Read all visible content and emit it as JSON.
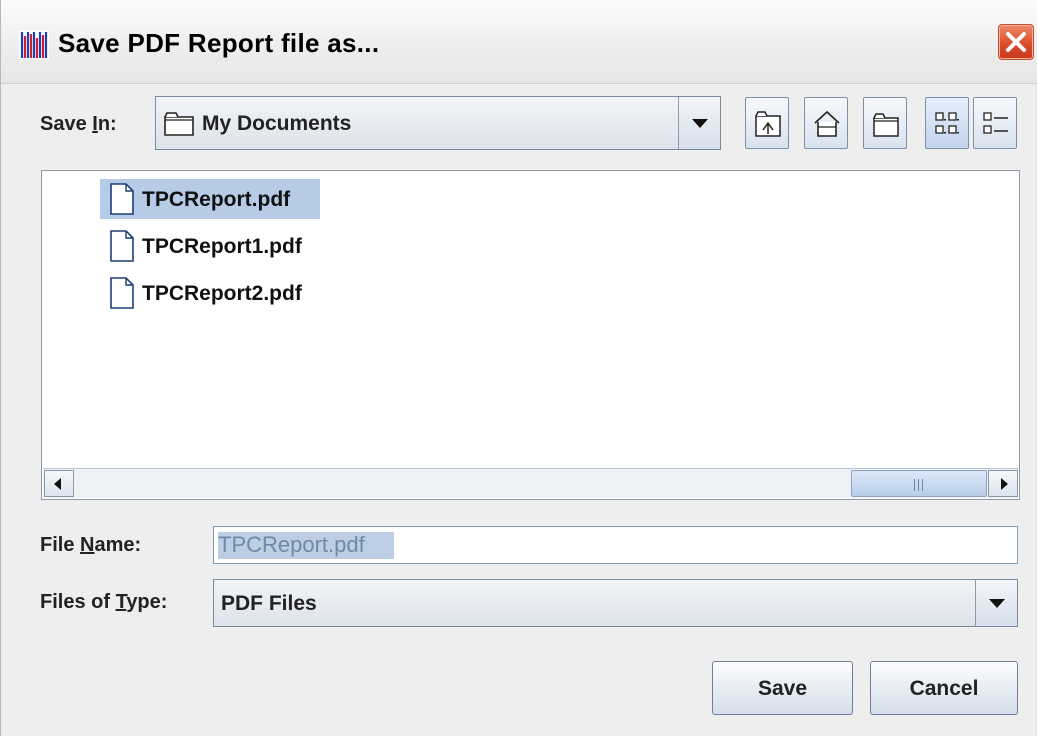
{
  "window": {
    "title": "Save PDF Report file as...",
    "close_icon": "close-icon"
  },
  "location": {
    "label": "Save In:",
    "label_parts": [
      "Save ",
      "I",
      "n:"
    ],
    "value": "My Documents",
    "icon": "folder-icon"
  },
  "toolbar": [
    {
      "name": "up-one-level",
      "icon": "folder-up-icon"
    },
    {
      "name": "home",
      "icon": "home-icon"
    },
    {
      "name": "create-new-folder",
      "icon": "new-folder-icon"
    },
    {
      "name": "list-view",
      "icon": "list-view-icon",
      "selected": true
    },
    {
      "name": "details-view",
      "icon": "details-view-icon"
    }
  ],
  "files": [
    {
      "name": "TPCReport.pdf",
      "selected": true,
      "icon": "file-icon"
    },
    {
      "name": "TPCReport1.pdf",
      "selected": false,
      "icon": "file-icon"
    },
    {
      "name": "TPCReport2.pdf",
      "selected": false,
      "icon": "file-icon"
    }
  ],
  "file_name": {
    "label_parts": [
      "File ",
      "N",
      "ame:"
    ],
    "value": "TPCReport.pdf"
  },
  "file_type": {
    "label_parts": [
      "Files of ",
      "T",
      "ype:"
    ],
    "value": "PDF Files"
  },
  "buttons": {
    "save": "Save",
    "cancel": "Cancel"
  },
  "colors": {
    "selection": "#b7cbe6",
    "close_button": "#d74a28"
  }
}
